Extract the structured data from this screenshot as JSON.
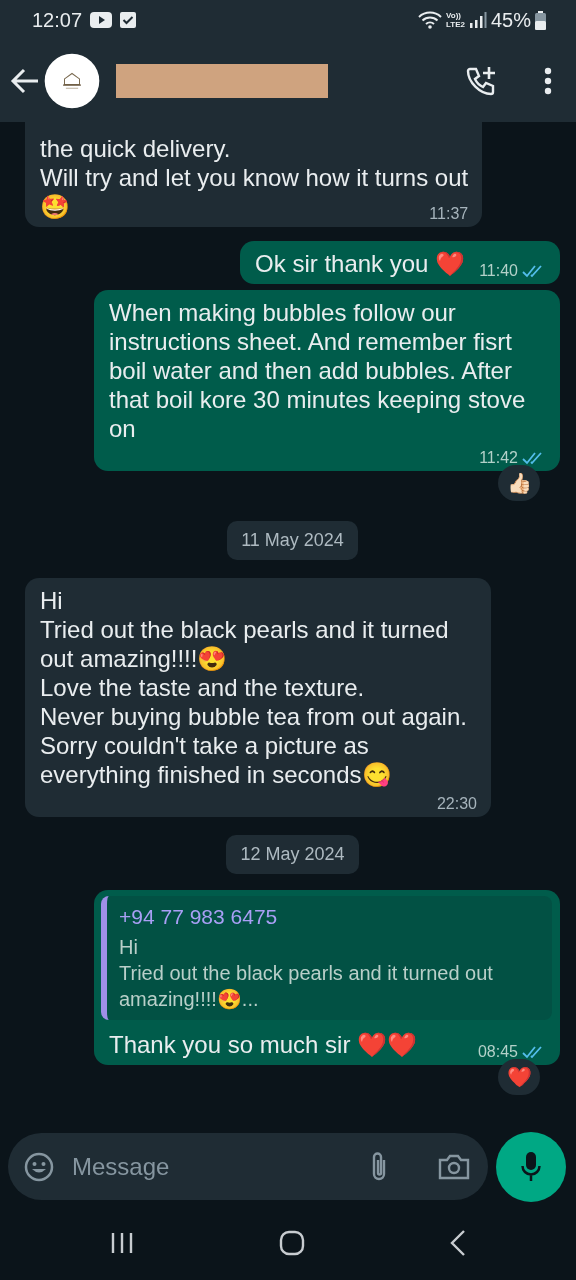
{
  "status_bar": {
    "time": "12:07",
    "network_top": "Vo))",
    "network_bottom": "LTE2",
    "battery": "45%"
  },
  "messages": [
    {
      "kind": "in",
      "cut_top": true,
      "paragraphs": [
        "the quick delivery.",
        "Will try and let you know how it turns out",
        "🤩"
      ],
      "time": "11:37"
    },
    {
      "kind": "out",
      "paragraphs": [
        "Ok sir thank you ❤️"
      ],
      "time": "11:40",
      "read": true
    },
    {
      "kind": "out",
      "paragraphs": [
        "When making bubbles follow our instructions sheet. And remember fisrt boil water and then add bubbles. After that boil kore 30 minutes keeping stove on"
      ],
      "time": "11:42",
      "read": true,
      "reaction": "👍🏻"
    },
    {
      "kind": "date",
      "text": "11 May 2024"
    },
    {
      "kind": "in",
      "paragraphs": [
        "Hi",
        "Tried out the black pearls and it turned out amazing!!!!😍",
        "Love the taste and the texture.",
        "Never buying bubble tea from out again.",
        "Sorry couldn't take a picture as everything finished in seconds😋"
      ],
      "time": "22:30"
    },
    {
      "kind": "date",
      "text": "12 May 2024"
    },
    {
      "kind": "out",
      "quote": {
        "author": "+94 77 983 6475",
        "paragraphs": [
          "Hi",
          "Tried out the black pearls and it turned out amazing!!!!😍..."
        ]
      },
      "paragraphs": [
        "Thank you so much sir ❤️❤️"
      ],
      "time": "08:45",
      "read": true,
      "reaction": "❤️"
    }
  ],
  "composer": {
    "placeholder": "Message"
  }
}
